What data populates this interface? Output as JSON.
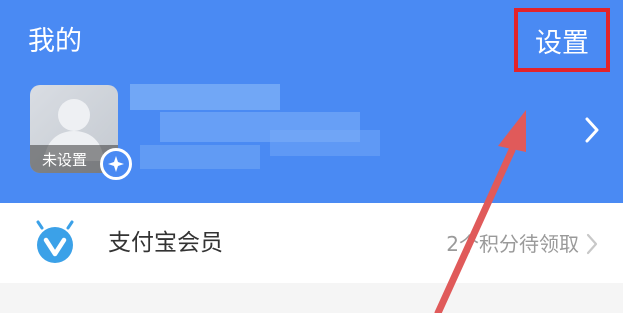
{
  "header": {
    "title": "我的",
    "settings_label": "设置",
    "background_color": "#4a8af3",
    "highlight_color": "#e3232a"
  },
  "profile": {
    "avatar_tag": "未设置",
    "avatar_icon": "default-person-avatar",
    "badge_icon": "sparkle-icon",
    "chevron_icon": "chevron-right-icon"
  },
  "menu": {
    "items": [
      {
        "label": "支付宝会员",
        "value": "2个积分待领取",
        "icon": "member-badge-icon",
        "icon_color": "#3ba1e8"
      }
    ]
  },
  "annotation": {
    "arrow_icon": "red-pointer-arrow",
    "arrow_color": "#e05a5a"
  }
}
